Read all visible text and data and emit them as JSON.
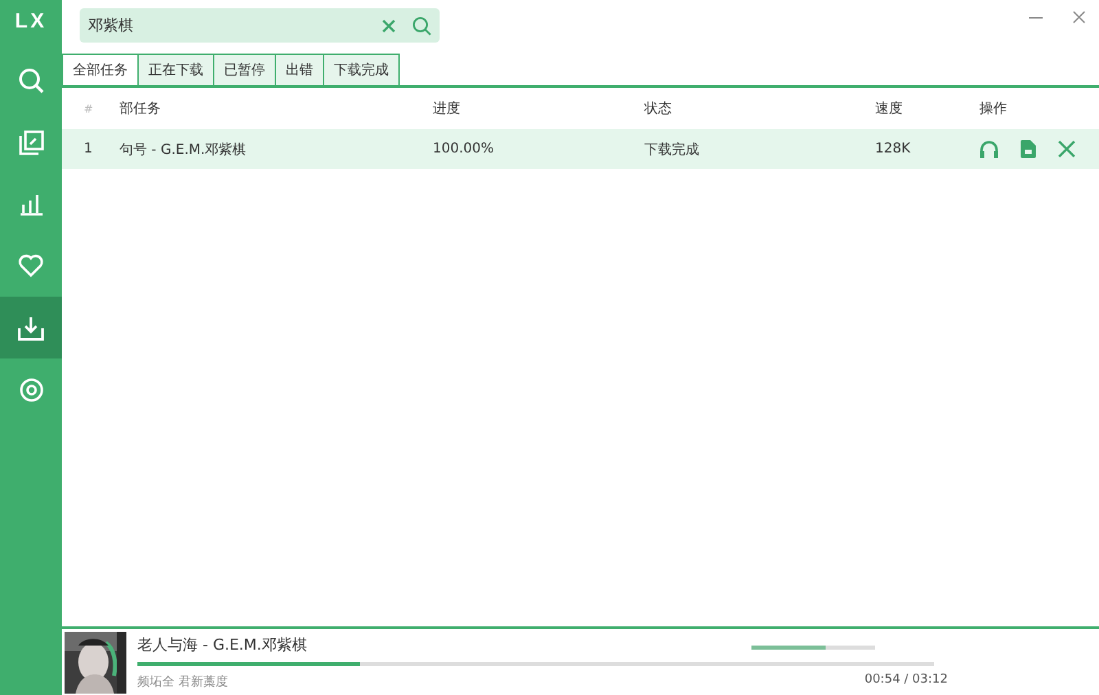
{
  "app": {
    "logo": "LX"
  },
  "sidebar": {
    "items": [
      {
        "selected": false
      },
      {
        "selected": false
      },
      {
        "selected": false
      },
      {
        "selected": false
      },
      {
        "selected": true
      },
      {
        "selected": false
      }
    ]
  },
  "search": {
    "value": "邓紫棋"
  },
  "tabs": [
    {
      "label": "全部任务",
      "selected": true
    },
    {
      "label": "正在下载",
      "selected": false
    },
    {
      "label": "已暂停",
      "selected": false
    },
    {
      "label": "出错",
      "selected": false
    },
    {
      "label": "下载完成",
      "selected": false
    }
  ],
  "table": {
    "columns": [
      "#",
      "部任务",
      "进度",
      "状态",
      "速度",
      "操作"
    ],
    "rows": [
      {
        "index": "1",
        "name": "句号 - G.E.M.邓紫棋",
        "progress": "100.00%",
        "status": "下载完成",
        "speed": "128K",
        "selected": true
      }
    ]
  },
  "player": {
    "title": "老人与海 - G.E.M.邓紫棋",
    "subtitle": "频坧全 君新藁度",
    "progress": {
      "level": 0.28
    },
    "volume": {
      "level": 0.6
    },
    "time": "00:54 / 03:12"
  }
}
